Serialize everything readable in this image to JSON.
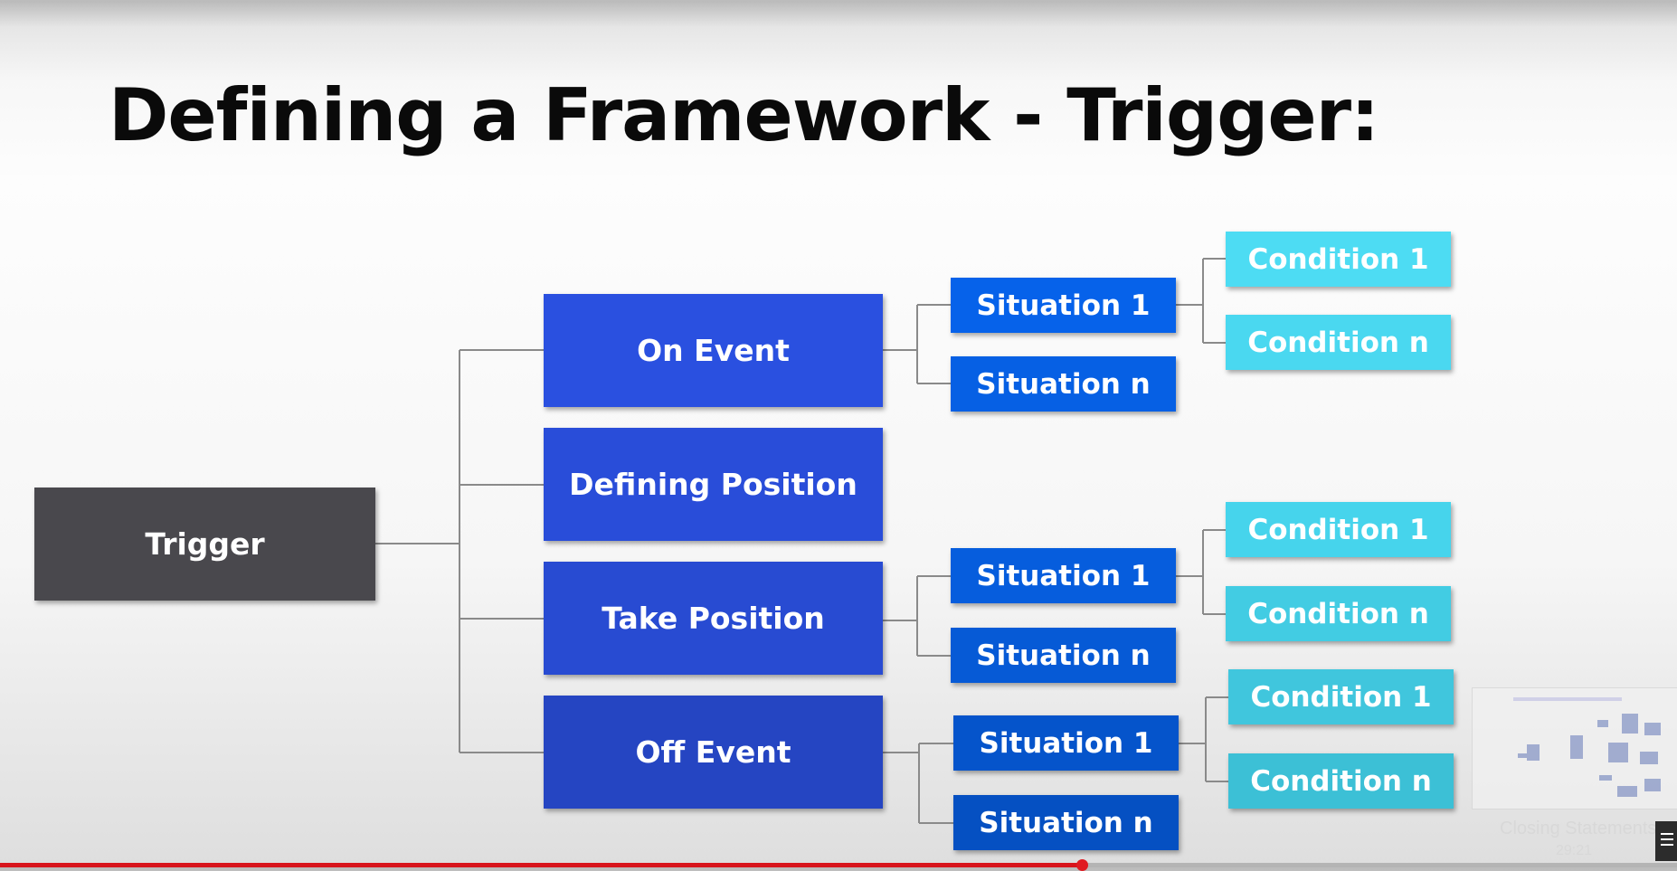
{
  "slide": {
    "title": "Defining a Framework - Trigger:"
  },
  "diagram": {
    "root": "Trigger",
    "categories": [
      "On Event",
      "Defining Position",
      "Take Position",
      "Off Event"
    ],
    "on_event": {
      "situations": [
        "Situation 1",
        "Situation n"
      ],
      "conditions": [
        "Condition 1",
        "Condition n"
      ]
    },
    "take_position": {
      "situations": [
        "Situation 1",
        "Situation n"
      ],
      "conditions": [
        "Condition 1",
        "Condition n"
      ]
    },
    "off_event": {
      "situations": [
        "Situation 1",
        "Situation n"
      ],
      "conditions": [
        "Condition 1",
        "Condition n"
      ]
    },
    "colors": {
      "trigger": "#49484d",
      "category": "#2a4fdf",
      "situation": "#0660e6",
      "condition": "#46d8f0",
      "connector": "#8a8a8a"
    }
  },
  "player": {
    "caption": "Closing Statements",
    "timestamp": "29:21",
    "progress": 0.645
  }
}
